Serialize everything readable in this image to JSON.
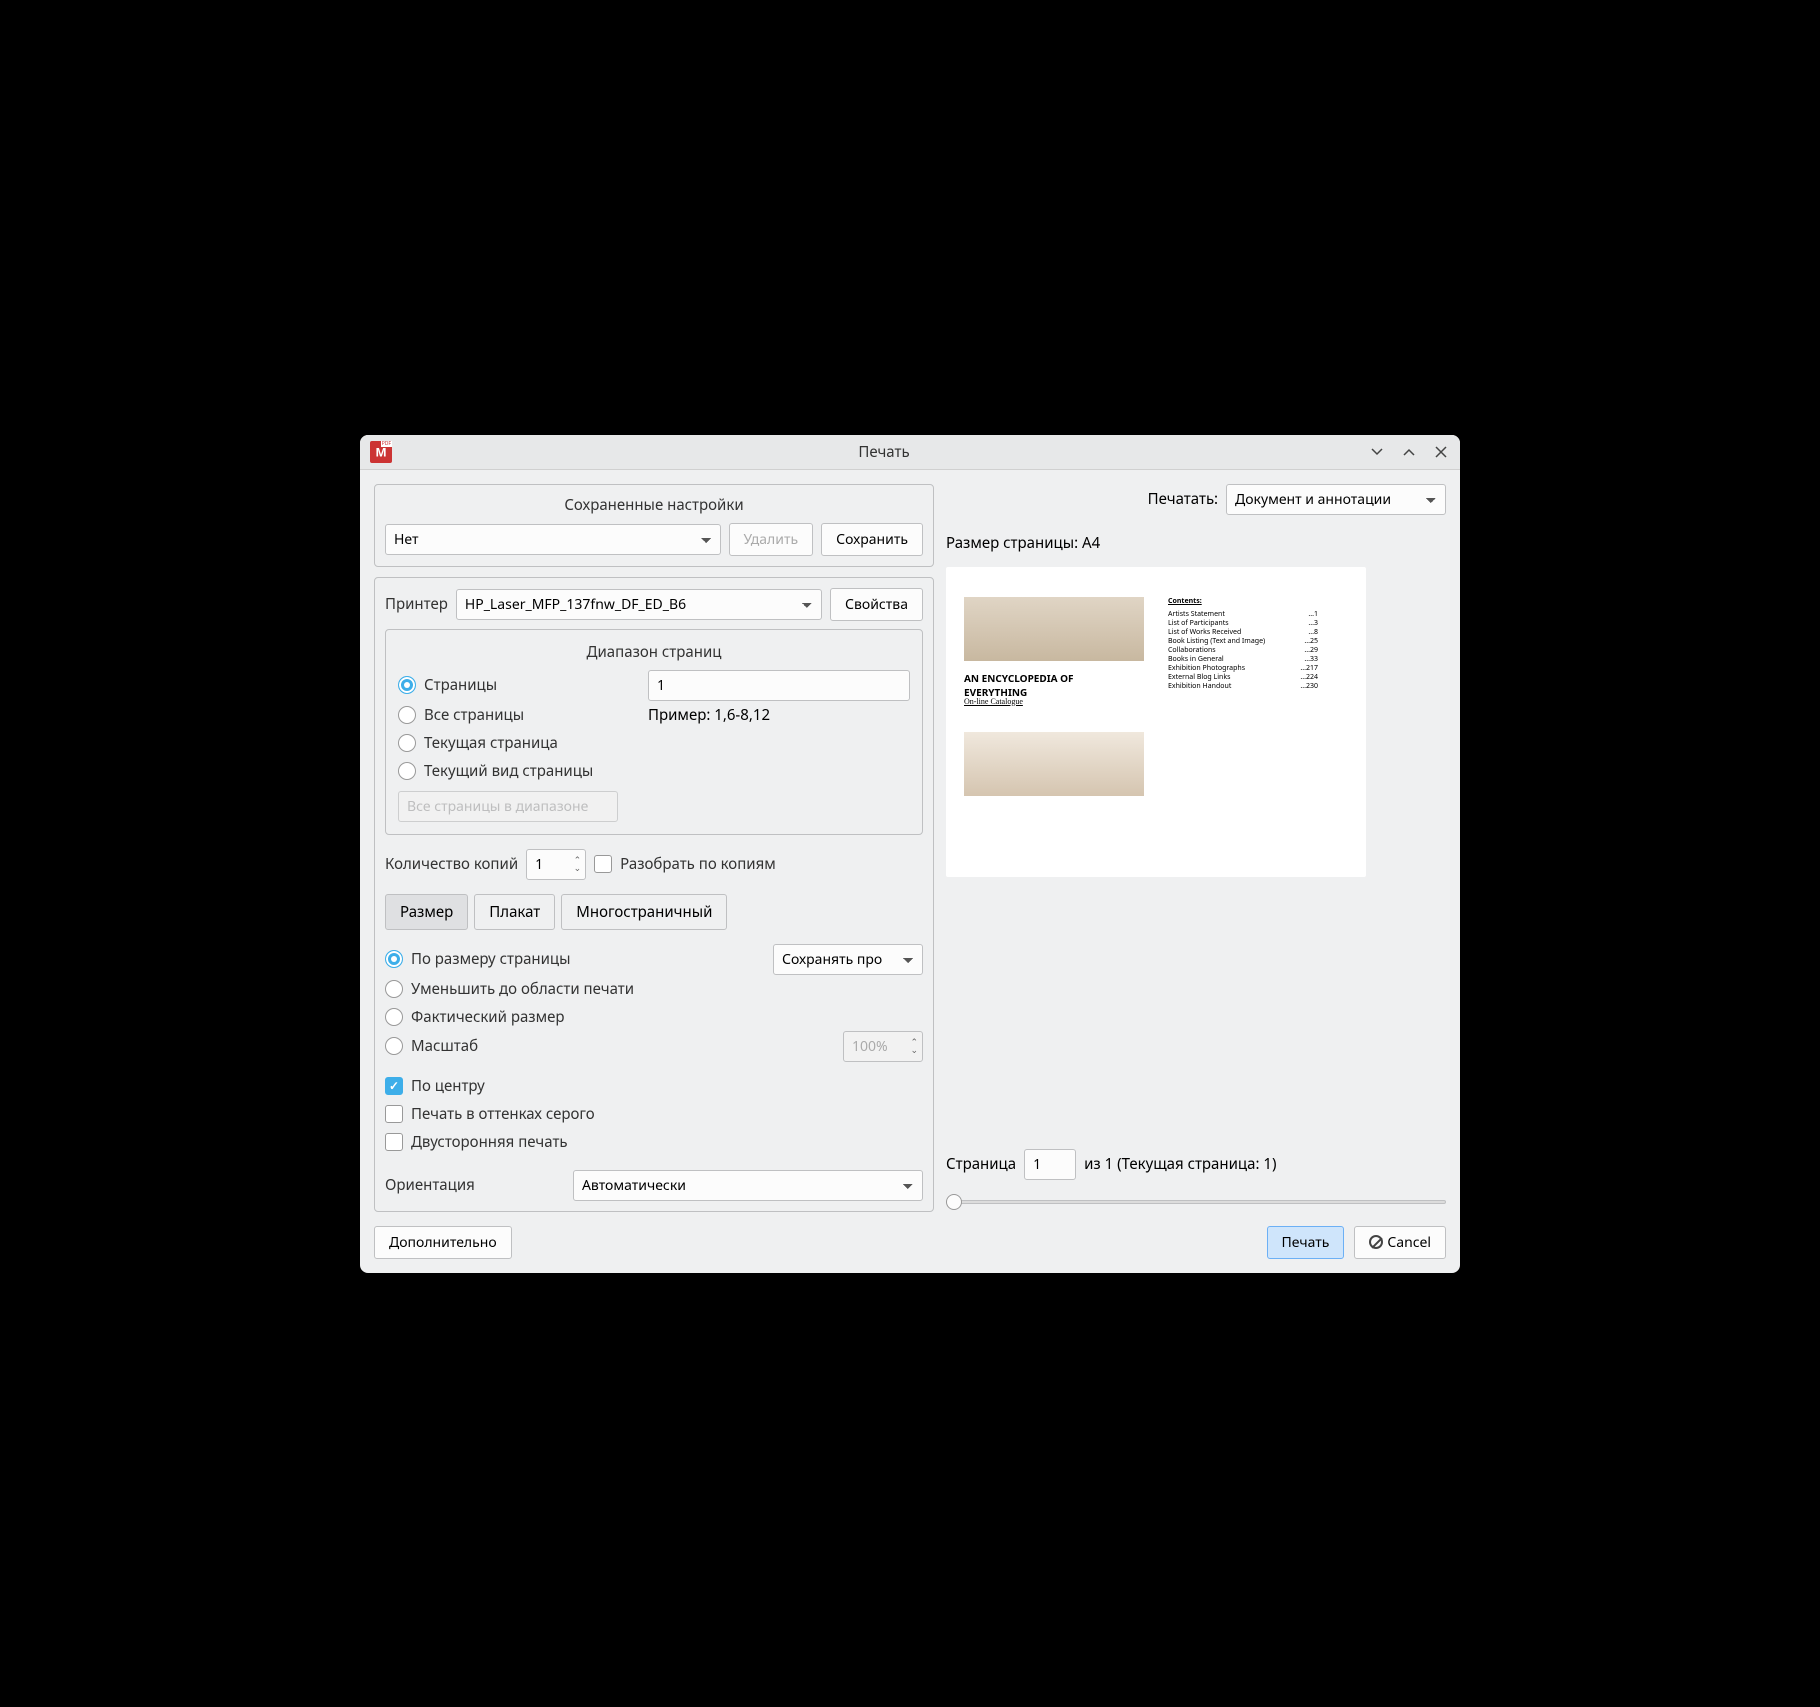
{
  "title": "Печать",
  "saved_settings": {
    "title": "Сохраненные настройки",
    "preset": "Нет",
    "delete": "Удалить",
    "save": "Сохранить"
  },
  "printer": {
    "label": "Принтер",
    "value": "HP_Laser_MFP_137fnw_DF_ED_B6",
    "props": "Свойства"
  },
  "range": {
    "title": "Диапазон страниц",
    "pages": "Страницы",
    "pages_value": "1",
    "all": "Все страницы",
    "example": "Пример: 1,6-8,12",
    "current": "Текущая страница",
    "view": "Текущий вид страницы",
    "subset": "Все страницы в диапазоне"
  },
  "copies": {
    "label": "Количество копий",
    "value": "1",
    "collate": "Разобрать по копиям"
  },
  "tabs": {
    "size": "Размер",
    "poster": "Плакат",
    "multi": "Многостраничный"
  },
  "size": {
    "fit": "По размеру страницы",
    "keep": "Сохранять про",
    "shrink": "Уменьшить до области печати",
    "actual": "Фактический размер",
    "scale": "Масштаб",
    "scale_value": "100%",
    "center": "По центру",
    "grayscale": "Печать в оттенках серого",
    "duplex": "Двусторонняя печать"
  },
  "orientation": {
    "label": "Ориентация",
    "value": "Автоматически"
  },
  "print_what": {
    "label": "Печатать:",
    "value": "Документ и аннотации"
  },
  "paper": {
    "label": "Размер страницы: A4"
  },
  "preview_doc": {
    "title1": "AN ENCYCLOPEDIA OF",
    "title2": "EVERYTHING",
    "sub": "On-line Catalogue",
    "contents_hdr": "Contents:",
    "lines": [
      {
        "t": "Artists Statement",
        "p": "...1"
      },
      {
        "t": "List of Participants",
        "p": "...3"
      },
      {
        "t": "List of Works Received",
        "p": "...8"
      },
      {
        "t": "Book Listing (Text and Image)",
        "p": "...25"
      },
      {
        "t": "Collaborations",
        "p": "...29"
      },
      {
        "t": "Books in General",
        "p": "...33"
      },
      {
        "t": "Exhibition Photographs",
        "p": "...217"
      },
      {
        "t": "External Blog Links",
        "p": "...224"
      },
      {
        "t": "Exhibition Handout",
        "p": "...230"
      }
    ]
  },
  "page_nav": {
    "label": "Страница",
    "value": "1",
    "of": "из 1 (Текущая страница: 1)"
  },
  "footer": {
    "advanced": "Дополнительно",
    "print": "Печать",
    "cancel": "Cancel"
  }
}
